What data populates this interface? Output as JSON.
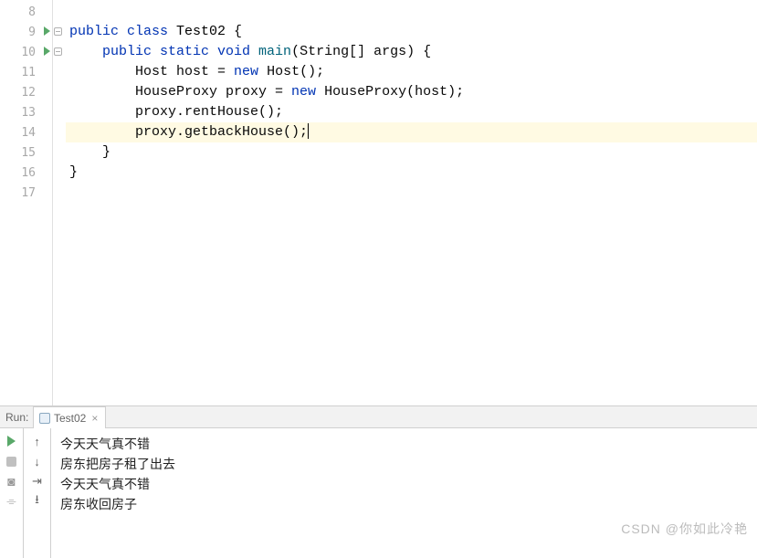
{
  "gutter": {
    "start": 8,
    "end": 17,
    "runnable": [
      9,
      10
    ]
  },
  "code": {
    "lines": [
      {
        "n": 8,
        "indent": "",
        "tokens": []
      },
      {
        "n": 9,
        "indent": "",
        "tokens": [
          {
            "t": "kw",
            "v": "public class "
          },
          {
            "t": "cls",
            "v": "Test02 "
          },
          {
            "t": "plain",
            "v": "{"
          }
        ]
      },
      {
        "n": 10,
        "indent": "    ",
        "tokens": [
          {
            "t": "kw",
            "v": "public static void "
          },
          {
            "t": "fn",
            "v": "main"
          },
          {
            "t": "plain",
            "v": "(String[] args) {"
          }
        ]
      },
      {
        "n": 11,
        "indent": "        ",
        "tokens": [
          {
            "t": "plain",
            "v": "Host host = "
          },
          {
            "t": "kw",
            "v": "new "
          },
          {
            "t": "plain",
            "v": "Host();"
          }
        ]
      },
      {
        "n": 12,
        "indent": "        ",
        "tokens": [
          {
            "t": "plain",
            "v": "HouseProxy proxy = "
          },
          {
            "t": "kw",
            "v": "new "
          },
          {
            "t": "plain",
            "v": "HouseProxy(host);"
          }
        ]
      },
      {
        "n": 13,
        "indent": "        ",
        "tokens": [
          {
            "t": "plain",
            "v": "proxy.rentHouse();"
          }
        ]
      },
      {
        "n": 14,
        "indent": "        ",
        "hl": true,
        "caret": true,
        "tokens": [
          {
            "t": "plain",
            "v": "proxy.getbackHouse();"
          }
        ]
      },
      {
        "n": 15,
        "indent": "    ",
        "tokens": [
          {
            "t": "plain",
            "v": "}"
          }
        ]
      },
      {
        "n": 16,
        "indent": "",
        "tokens": [
          {
            "t": "plain",
            "v": "}"
          }
        ]
      },
      {
        "n": 17,
        "indent": "",
        "tokens": []
      }
    ]
  },
  "run": {
    "label": "Run:",
    "tab": "Test02",
    "output": [
      "今天天气真不错",
      "房东把房子租了出去",
      "今天天气真不错",
      "房东收回房子"
    ]
  },
  "watermark": "CSDN @你如此冷艳"
}
